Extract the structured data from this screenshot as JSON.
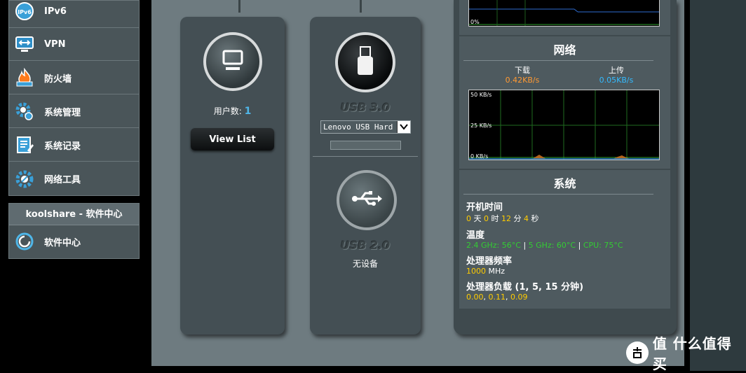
{
  "sidebar": {
    "items": [
      {
        "label": "IPv6",
        "icon": "ipv6-icon"
      },
      {
        "label": "VPN",
        "icon": "vpn-icon"
      },
      {
        "label": "防火墙",
        "icon": "firewall-icon"
      },
      {
        "label": "系统管理",
        "icon": "gear-icon"
      },
      {
        "label": "系统记录",
        "icon": "log-icon"
      },
      {
        "label": "网络工具",
        "icon": "network-tools-icon"
      }
    ]
  },
  "koolshare": {
    "header": "koolshare - 软件中心",
    "item_label": "软件中心"
  },
  "clients": {
    "count_label": "用户数:",
    "count": "1",
    "view_list_label": "View List"
  },
  "usb": {
    "usb3_label": "USB 3.0",
    "usb3_device": "Lenovo USB Hard Drive",
    "usb2_label": "USB 2.0",
    "usb2_status": "无设备"
  },
  "cpu_graph": {
    "bottom_label": "0%"
  },
  "network": {
    "title": "网络",
    "download_label": "下载",
    "download_value": "0.42KB/s",
    "upload_label": "上传",
    "upload_value": "0.05KB/s",
    "y_ticks": [
      "50 KB/s",
      "25 KB/s",
      "0 KB/s"
    ]
  },
  "system": {
    "title": "系统",
    "uptime_label": "开机时间",
    "uptime": {
      "days": "0",
      "d_unit": "天",
      "hours": "0",
      "h_unit": "时",
      "minutes": "12",
      "m_unit": "分",
      "seconds": "4",
      "s_unit": "秒"
    },
    "temp_label": "温度",
    "temp": {
      "ghz24": "2.4 GHz: 56°C",
      "ghz5": "5 GHz: 60°C",
      "cpu": "CPU: 75°C"
    },
    "freq_label": "处理器频率",
    "freq_value": "1000",
    "freq_unit": "MHz",
    "load_label": "处理器负载 (1, 5, 15 分钟)",
    "load": [
      "0.00",
      "0.11",
      "0.09"
    ]
  },
  "watermark": {
    "text": "值 什么值得买"
  },
  "colors": {
    "orange": "#ff9933",
    "blue": "#33bbff",
    "green": "#33cc33",
    "yellow": "#ffcc00"
  }
}
